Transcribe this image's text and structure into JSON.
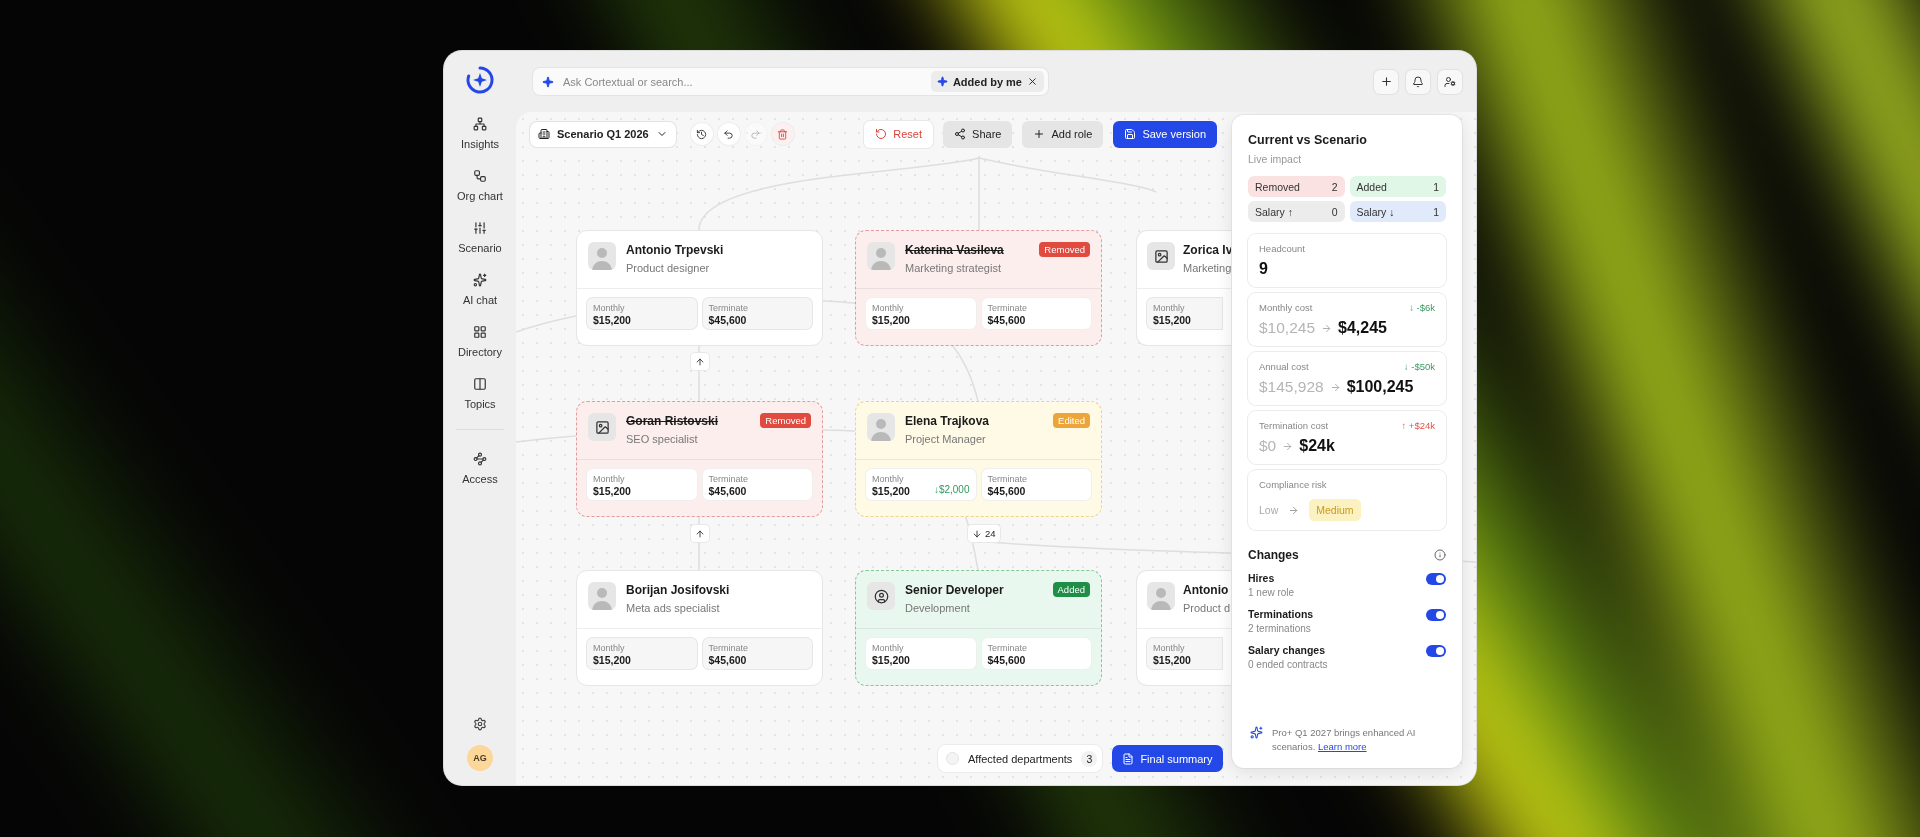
{
  "sidebar": {
    "items": [
      {
        "label": "Insights"
      },
      {
        "label": "Org chart"
      },
      {
        "label": "Scenario"
      },
      {
        "label": "AI chat"
      },
      {
        "label": "Directory"
      },
      {
        "label": "Topics"
      }
    ],
    "secondary_items": [
      {
        "label": "Access"
      }
    ],
    "avatar": "AG"
  },
  "topbar": {
    "search": {
      "placeholder": "Ask Cortextual or search..."
    },
    "filter_chip": "Added by me"
  },
  "toolbar": {
    "scenario_select": "Scenario Q1 2026",
    "tools": [
      {
        "kind": "history",
        "disabled": false
      },
      {
        "kind": "undo",
        "disabled": false
      },
      {
        "kind": "redo",
        "disabled": true
      },
      {
        "kind": "delete",
        "disabled": false
      }
    ],
    "buttons": [
      {
        "kind": "reset",
        "label": "Reset"
      },
      {
        "kind": "share",
        "label": "Share"
      },
      {
        "kind": "add",
        "label": "Add role"
      },
      {
        "kind": "save",
        "label": "Save version"
      }
    ]
  },
  "org_chart": {
    "rows": [
      {
        "cards": [
          {
            "kind": "normal",
            "avatar": {
              "kind": "photo"
            },
            "name": "Antonio Trpevski",
            "role": "Product designer",
            "stats": [
              {
                "label": "Monthly",
                "value": "$15,200"
              },
              {
                "label": "Terminate",
                "value": "$45,600"
              }
            ]
          },
          {
            "kind": "removed",
            "badge": "Removed",
            "avatar": {
              "kind": "photo"
            },
            "name": "Katerina Vasileva",
            "role": "Marketing strategist",
            "stats": [
              {
                "label": "Monthly",
                "value": "$15,200"
              },
              {
                "label": "Terminate",
                "value": "$45,600"
              }
            ]
          },
          {
            "kind": "normal",
            "avatar": {
              "kind": "image"
            },
            "name": "Zorica Iv",
            "role": "Marketing",
            "stats": [
              {
                "label": "Monthly",
                "value": "$15,200"
              }
            ]
          }
        ]
      },
      {
        "cards": [
          {
            "kind": "removed",
            "badge": "Removed",
            "avatar": {
              "kind": "image"
            },
            "name": "Goran Ristovski",
            "role": "SEO specialist",
            "stats": [
              {
                "label": "Monthly",
                "value": "$15,200"
              },
              {
                "label": "Terminate",
                "value": "$45,600"
              }
            ]
          },
          {
            "kind": "edited",
            "badge": "Edited",
            "avatar": {
              "kind": "photo"
            },
            "name": "Elena Trajkova",
            "role": "Project Manager",
            "stats": [
              {
                "label": "Monthly",
                "value": "$15,200",
                "delta": "↓$2,000"
              },
              {
                "label": "Terminate",
                "value": "$45,600"
              }
            ]
          }
        ]
      },
      {
        "cards": [
          {
            "kind": "normal",
            "avatar": {
              "kind": "photo"
            },
            "name": "Borijan Josifovski",
            "role": "Meta ads specialist",
            "stats": [
              {
                "label": "Monthly",
                "value": "$15,200"
              },
              {
                "label": "Terminate",
                "value": "$45,600"
              }
            ]
          },
          {
            "kind": "added",
            "badge": "Added",
            "avatar": {
              "kind": "person"
            },
            "name": "Senior Developer",
            "role": "Development",
            "stats": [
              {
                "label": "Monthly",
                "value": "$15,200"
              },
              {
                "label": "Terminate",
                "value": "$45,600"
              }
            ]
          },
          {
            "kind": "normal",
            "avatar": {
              "kind": "photo"
            },
            "name": "Antonio",
            "role": "Product d",
            "stats": [
              {
                "label": "Monthly",
                "value": "$15,200"
              }
            ]
          }
        ]
      }
    ],
    "expanders": [
      {
        "kind": "up"
      },
      {
        "kind": "up"
      },
      {
        "kind": "down",
        "count": "24"
      }
    ]
  },
  "bottom_bar": {
    "departments": {
      "label": "Affected departments",
      "count": "3"
    },
    "summary_button": "Final summary"
  },
  "panel": {
    "title": "Current vs Scenario",
    "subtitle": "Live impact",
    "chips": [
      {
        "label": "Removed",
        "count": "2",
        "color": "#fbe2e2"
      },
      {
        "label": "Added",
        "count": "1",
        "color": "#e0f6e6"
      },
      {
        "label": "Salary ↑",
        "count": "0",
        "color": "#ececec"
      },
      {
        "label": "Salary ↓",
        "count": "1",
        "color": "#e0eafb"
      }
    ],
    "metrics": [
      {
        "kind": "value",
        "label": "Headcount",
        "value": "9"
      },
      {
        "kind": "change",
        "label": "Monthly cost",
        "from": "$10,245",
        "to": "$4,245",
        "delta": {
          "text": "↓ -$6k",
          "kind": "down"
        }
      },
      {
        "kind": "change",
        "label": "Annual cost",
        "from": "$145,928",
        "to": "$100,245",
        "delta": {
          "text": "↓ -$50k",
          "kind": "down"
        }
      },
      {
        "kind": "change",
        "label": "Termination cost",
        "from": "$0",
        "to": "$24k",
        "delta": {
          "text": "↑ +$24k",
          "kind": "up"
        }
      },
      {
        "kind": "risk",
        "label": "Compliance risk",
        "from": "Low",
        "to": "Medium"
      }
    ],
    "changes_title": "Changes",
    "changes": [
      {
        "title": "Hires",
        "detail": "1 new role",
        "on": true
      },
      {
        "title": "Terminations",
        "detail": "2 terminations",
        "on": true
      },
      {
        "title": "Salary changes",
        "detail": "0 ended contracts",
        "on": true
      }
    ],
    "footer": {
      "text": "Pro+ Q1 2027 brings enhanced AI scenarios.",
      "link": "Learn more"
    }
  }
}
